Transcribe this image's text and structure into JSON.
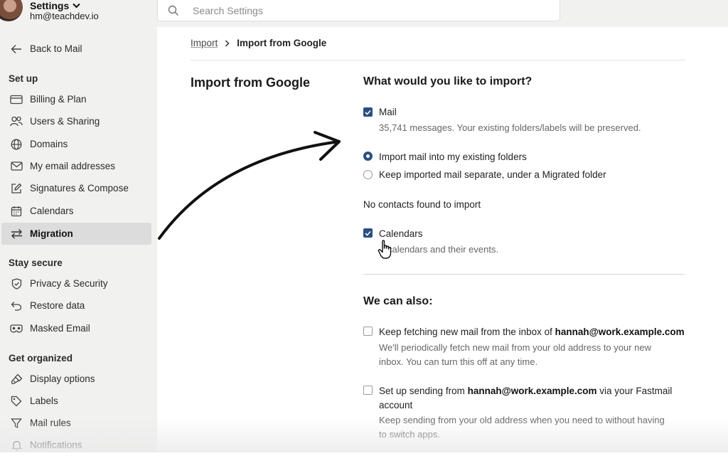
{
  "account": {
    "title": "Settings",
    "email": "hm@teachdev.io"
  },
  "search": {
    "placeholder": "Search Settings"
  },
  "sidebar": {
    "back_label": "Back to Mail",
    "sections": [
      {
        "label": "Set up"
      },
      {
        "label": "Stay secure"
      },
      {
        "label": "Get organized"
      }
    ],
    "items": [
      {
        "label": "Billing & Plan",
        "icon": "credit-card-icon"
      },
      {
        "label": "Users & Sharing",
        "icon": "users-icon"
      },
      {
        "label": "Domains",
        "icon": "globe-icon"
      },
      {
        "label": "My email addresses",
        "icon": "envelope-icon"
      },
      {
        "label": "Signatures & Compose",
        "icon": "pencil-square-icon"
      },
      {
        "label": "Calendars",
        "icon": "calendar-icon"
      },
      {
        "label": "Migration",
        "icon": "swap-arrows-icon",
        "active": true
      },
      {
        "label": "Privacy & Security",
        "icon": "shield-check-icon"
      },
      {
        "label": "Restore data",
        "icon": "undo-arrow-icon"
      },
      {
        "label": "Masked Email",
        "icon": "mask-icon"
      },
      {
        "label": "Display options",
        "icon": "brush-icon"
      },
      {
        "label": "Labels",
        "icon": "tag-icon"
      },
      {
        "label": "Mail rules",
        "icon": "filter-icon"
      },
      {
        "label": "Notifications",
        "icon": "bell-icon"
      }
    ]
  },
  "breadcrumb": {
    "parent": "Import",
    "current": "Import from Google"
  },
  "main": {
    "page_title": "Import from Google",
    "question": "What would you like to import?",
    "mail": {
      "label": "Mail",
      "checked": true,
      "description": "35,741 messages. Your existing folders/labels will be preserved."
    },
    "mail_options": [
      {
        "label": "Import mail into my existing folders",
        "selected": true
      },
      {
        "label": "Keep imported mail separate, under a Migrated folder",
        "selected": false
      }
    ],
    "contacts_note": "No contacts found to import",
    "calendars": {
      "label": "Calendars",
      "checked": true,
      "description": "calendars and their events."
    },
    "also_title": "We can also:",
    "fetch": {
      "checked": false,
      "label_prefix": "Keep fetching new mail from the inbox of ",
      "email": "hannah@work.example.com",
      "description_line1": "We'll periodically fetch new mail from your old address to your new",
      "description_line2": "inbox. You can turn this off at any time."
    },
    "sending": {
      "checked": false,
      "label_prefix": "Set up sending from ",
      "email": "hannah@work.example.com",
      "label_suffix": " via your Fastmail",
      "label_line2": "account",
      "description_line1": "Keep sending from your old address when you need to without having",
      "description_line2": "to switch apps."
    }
  },
  "colors": {
    "accent": "#2a4f86",
    "sidebar_bg": "#f1f1f0",
    "active_item_bg": "#dcdcdc"
  }
}
